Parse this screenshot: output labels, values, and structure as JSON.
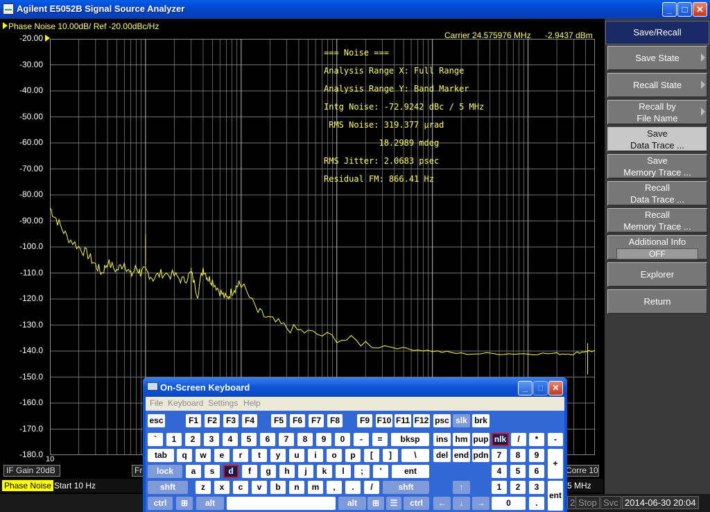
{
  "window": {
    "title": "Agilent E5052B Signal Source Analyzer",
    "minimize": "_",
    "maximize": "□",
    "close": "✕"
  },
  "header": {
    "trace_setting": "Phase Noise 10.00dB/ Ref -20.00dBc/Hz",
    "carrier": "Carrier 24.575976 MHz",
    "carrier_power": "-2.9437 dBm"
  },
  "noise_readout": {
    "title": "=== Noise ===",
    "range_x": "Analysis Range X: Full Range",
    "range_y": "Analysis Range Y: Band Marker",
    "intg_noise": "Intg Noise: -72.9242 dBc / 5 MHz",
    "rms_noise_rad": " RMS Noise: 319.377 µrad",
    "rms_noise_deg": "           18.2989 mdeg",
    "rms_jitter": "RMS Jitter: 2.0683 psec",
    "residual_fm": "Residual FM: 866.41 Hz"
  },
  "chart_data": {
    "type": "line",
    "title": "Phase Noise 10.00dB/ Ref -20.00dBc/Hz",
    "xscale": "log",
    "xlim_hz": [
      10,
      5000000
    ],
    "ylim": [
      -180,
      -20
    ],
    "ylabel_ticks": [
      "-20.00",
      "-30.00",
      "-40.00",
      "-50.00",
      "-60.00",
      "-70.00",
      "-80.00",
      "-90.00",
      "-100.0",
      "-110.0",
      "-120.0",
      "-130.0",
      "-140.0",
      "-150.0",
      "-160.0",
      "-170.0",
      "-180.0"
    ],
    "x_start_label": "10",
    "grid": true,
    "trace_color": "#ffff33",
    "series": [
      {
        "x": [
          10,
          12,
          15,
          20,
          25,
          30,
          35,
          40,
          50,
          60,
          70,
          80,
          90,
          100,
          120,
          150,
          200,
          250,
          300,
          350,
          400,
          450,
          500,
          600,
          700,
          800,
          900,
          1000,
          1500,
          2000,
          3000,
          5000,
          10000,
          20000,
          50000,
          100000,
          200000,
          500000,
          1000000,
          2000000,
          3000000,
          4000000,
          5000000
        ],
        "y": [
          -85,
          -90,
          -96,
          -100,
          -103,
          -107,
          -110,
          -106,
          -109,
          -106,
          -111,
          -108,
          -110,
          -109,
          -112,
          -110,
          -111,
          -113,
          -110,
          -118,
          -108,
          -112,
          -113,
          -117,
          -120,
          -117,
          -115,
          -114,
          -125,
          -128,
          -131,
          -133,
          -135,
          -137,
          -139,
          -140,
          -141,
          -141,
          -141,
          -141,
          -141,
          -140,
          -140
        ]
      }
    ],
    "spurs": [
      {
        "x": 100,
        "y": -95
      },
      {
        "x": 300,
        "y": -108
      },
      {
        "x": 4200000,
        "y": -137
      }
    ]
  },
  "status": {
    "if_gain": "IF Gain 20dB",
    "freq_partial": "Fr",
    "corre_partial": "Corre 10",
    "trace_mode": "Phase Noise",
    "start": "Start 10 Hz",
    "stop_partial": "5 MHz",
    "ch_partial": "2",
    "stop_state": "Stop",
    "svc": "Svc",
    "datetime": "2014-06-30 20:04"
  },
  "softkeys": {
    "title": "Save/Recall",
    "items": [
      {
        "line1": "Save State",
        "line2": ""
      },
      {
        "line1": "Recall State",
        "line2": ""
      },
      {
        "line1": "Recall by",
        "line2": "File Name"
      },
      {
        "line1": "Save",
        "line2": "Data Trace ..."
      },
      {
        "line1": "Save",
        "line2": "Memory Trace ..."
      },
      {
        "line1": "Recall",
        "line2": "Data Trace ..."
      },
      {
        "line1": "Recall",
        "line2": "Memory Trace ..."
      },
      {
        "line1": "Additional Info",
        "line2": "OFF"
      },
      {
        "line1": "Explorer",
        "line2": ""
      },
      {
        "line1": "Return",
        "line2": ""
      }
    ]
  },
  "osk": {
    "title": "On-Screen Keyboard",
    "menu": [
      "File",
      "Keyboard",
      "Settings",
      "Help"
    ],
    "keys": {
      "esc": "esc",
      "f1": "F1",
      "f2": "F2",
      "f3": "F3",
      "f4": "F4",
      "f5": "F5",
      "f6": "F6",
      "f7": "F7",
      "f8": "F8",
      "f9": "F9",
      "f10": "F10",
      "f11": "F11",
      "f12": "F12",
      "psc": "psc",
      "slk": "slk",
      "brk": "brk",
      "grave": "`",
      "k1": "1",
      "k2": "2",
      "k3": "3",
      "k4": "4",
      "k5": "5",
      "k6": "6",
      "k7": "7",
      "k8": "8",
      "k9": "9",
      "k0": "0",
      "minus": "-",
      "equals": "=",
      "bksp": "bksp",
      "ins": "ins",
      "hm": "hm",
      "pup": "pup",
      "nlk": "nlk",
      "slash": "/",
      "star": "*",
      "nminus": "-",
      "tab": "tab",
      "q": "q",
      "w": "w",
      "e": "e",
      "r": "r",
      "t": "t",
      "y": "y",
      "u": "u",
      "i": "i",
      "o": "o",
      "p": "p",
      "lbr": "[",
      "rbr": "]",
      "bslash": "\\",
      "del": "del",
      "end": "end",
      "pdn": "pdn",
      "n7": "7",
      "n8": "8",
      "n9": "9",
      "plus": "+",
      "lock": "lock",
      "a": "a",
      "s": "s",
      "d": "d",
      "f": "f",
      "g": "g",
      "h": "h",
      "j": "j",
      "k": "k",
      "l": "l",
      "semi": ";",
      "quote": "'",
      "ent": "ent",
      "n4": "4",
      "n5": "5",
      "n6": "6",
      "shft": "shft",
      "z": "z",
      "x": "x",
      "c": "c",
      "v": "v",
      "b": "b",
      "n": "n",
      "m": "m",
      "comma": ",",
      "period": ".",
      "fslash": "/",
      "up": "↑",
      "n1": "1",
      "n2": "2",
      "n3": "3",
      "ctrl": "ctrl",
      "alt": "alt",
      "left": "←",
      "down": "↓",
      "right": "→",
      "n0": "0",
      "ndot": ".",
      "nent": "ent"
    }
  }
}
